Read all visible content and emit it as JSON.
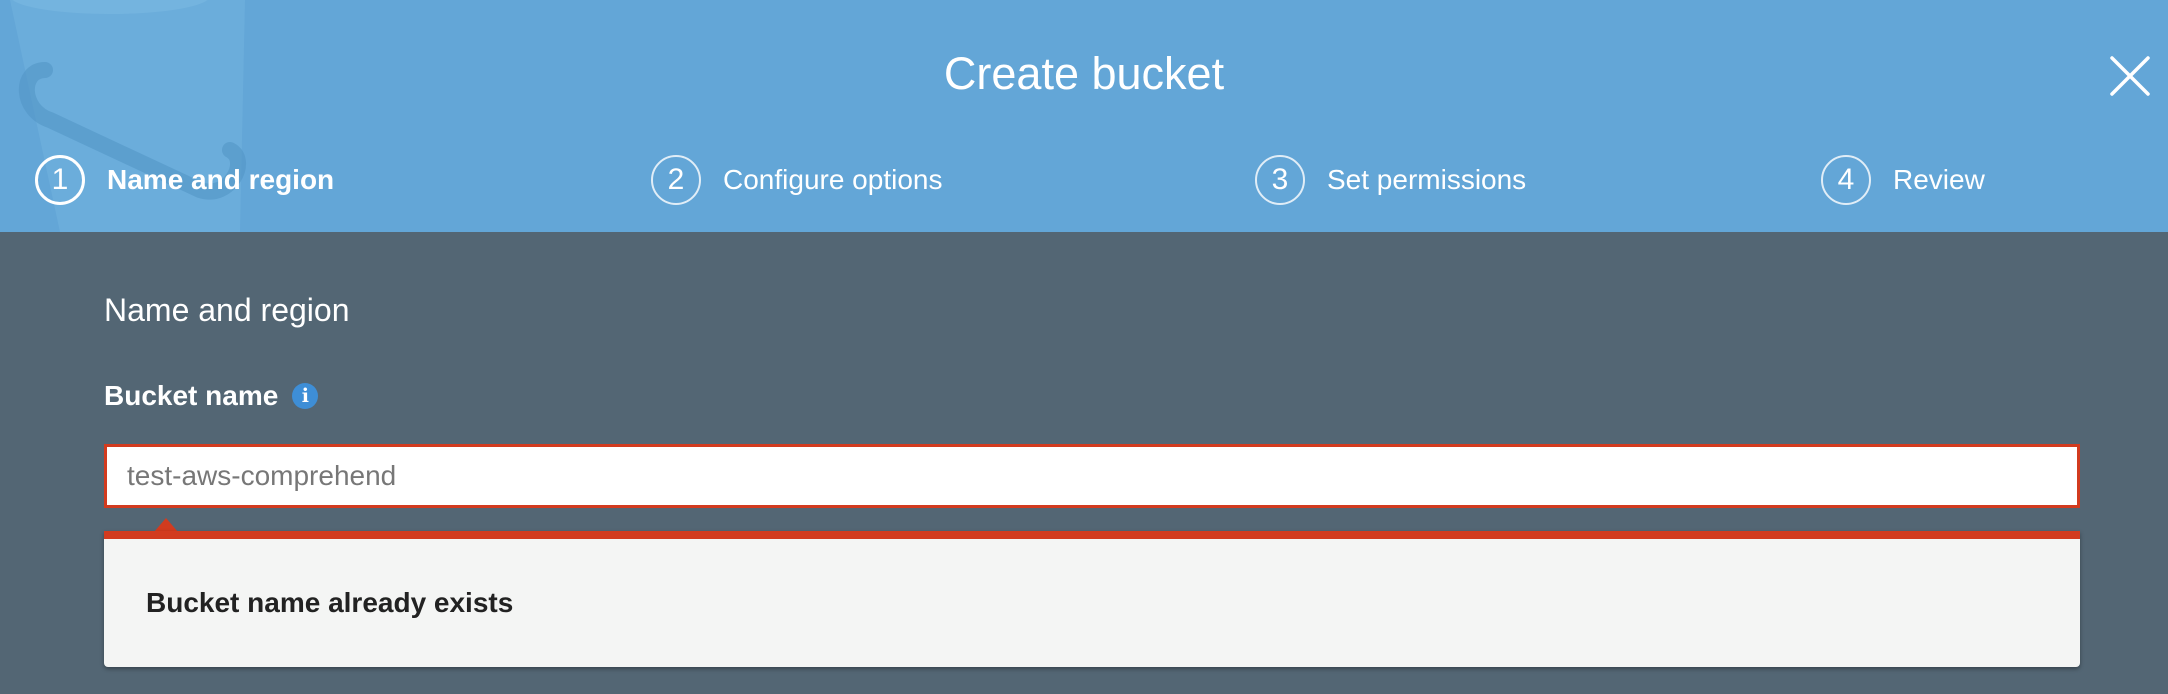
{
  "header": {
    "title": "Create bucket",
    "close_icon": "close-icon",
    "background_color": "#63a6d7"
  },
  "steps": [
    {
      "number": "1",
      "label": "Name and region",
      "active": true
    },
    {
      "number": "2",
      "label": "Configure options",
      "active": false
    },
    {
      "number": "3",
      "label": "Set permissions",
      "active": false
    },
    {
      "number": "4",
      "label": "Review",
      "active": false
    }
  ],
  "main": {
    "section_title": "Name and region",
    "bucket_name": {
      "label": "Bucket name",
      "info_icon": "info-icon",
      "info_glyph": "i",
      "value": "test-aws-comprehend"
    },
    "error": {
      "message": "Bucket name already exists",
      "color": "#d23b1f"
    }
  },
  "colors": {
    "body_background": "#536674",
    "accent": "#3e8ed6"
  }
}
